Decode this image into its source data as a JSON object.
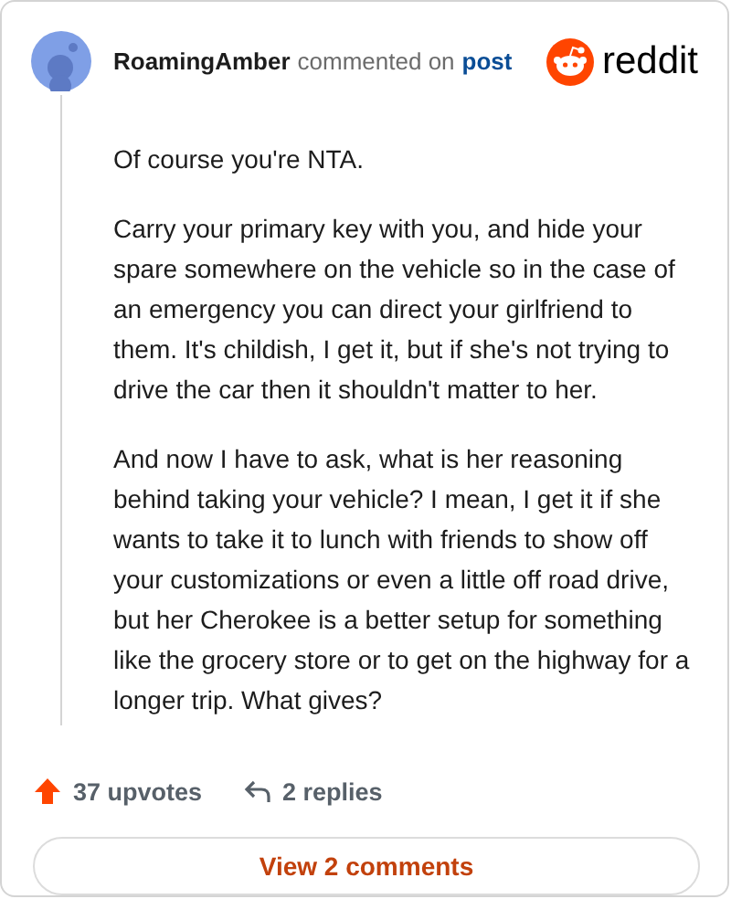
{
  "header": {
    "username": "RoamingAmber",
    "action": "commented on",
    "link": "post",
    "brand": "reddit"
  },
  "paragraphs": [
    "Of course you're NTA.",
    "Carry your primary key with you, and hide your spare somewhere on the vehicle so in the case of an emergency you can direct your girlfriend to them. It's childish, I get it, but if she's not trying to drive the car then it shouldn't matter to her.",
    "And now I have to ask, what is her reasoning behind taking your vehicle? I mean, I get it if she wants to take it to lunch with friends to show off your customizations or even a little off road drive, but her Cherokee is a better setup for something like the grocery store or to get on the highway for a longer trip. What gives?"
  ],
  "stats": {
    "upvotes": "37 upvotes",
    "replies": "2 replies"
  },
  "button": "View 2 comments"
}
